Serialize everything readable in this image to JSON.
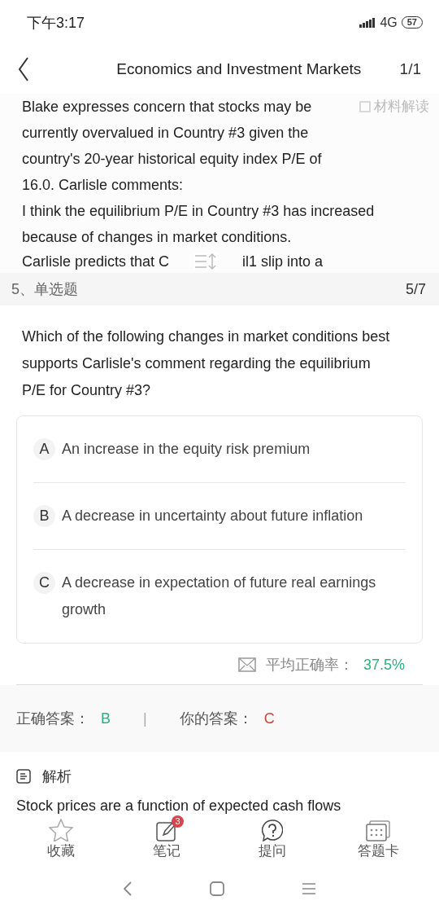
{
  "status_bar": {
    "time": "下午3:17",
    "network": "4G",
    "battery": "57"
  },
  "header": {
    "title": "Economics and Investment Markets",
    "page": "1/1"
  },
  "passage": {
    "lines": [
      "Blake expresses concern that stocks may be currently overvalued in Country #3 given the country's 20-year historical equity index P/E of 16.0. Carlisle comments:",
      "I think the equilibrium P/E in Country #3 has increased because of changes in market conditions."
    ],
    "cut_left": "Carlisle predicts that C",
    "cut_right": "il1 slip into a",
    "material_button": "材料解读"
  },
  "question_bar": {
    "label": "5、单选题",
    "progress": "5/7"
  },
  "question": "Which of the following changes in market conditions best supports Carlisle's comment regarding the equilibrium P/E for Country #3?",
  "options": [
    {
      "letter": "A",
      "text": "An increase in the equity risk premium"
    },
    {
      "letter": "B",
      "text": "A decrease in uncertainty about future inflation"
    },
    {
      "letter": "C",
      "text": "A decrease in expectation of future real earnings growth"
    }
  ],
  "accuracy": {
    "label": "平均正确率：",
    "value": "37.5%"
  },
  "answers": {
    "correct_label": "正确答案：",
    "correct": "B",
    "separator": "|",
    "yours_label": "你的答案：",
    "yours": "C"
  },
  "analysis": {
    "title": "解析",
    "text": "Stock prices are a function of expected cash flows"
  },
  "bottom_nav": [
    {
      "kind": "star",
      "label": "收藏"
    },
    {
      "kind": "note",
      "label": "笔记",
      "badge": "3"
    },
    {
      "kind": "ask",
      "label": "提问"
    },
    {
      "kind": "card",
      "label": "答题卡"
    }
  ]
}
